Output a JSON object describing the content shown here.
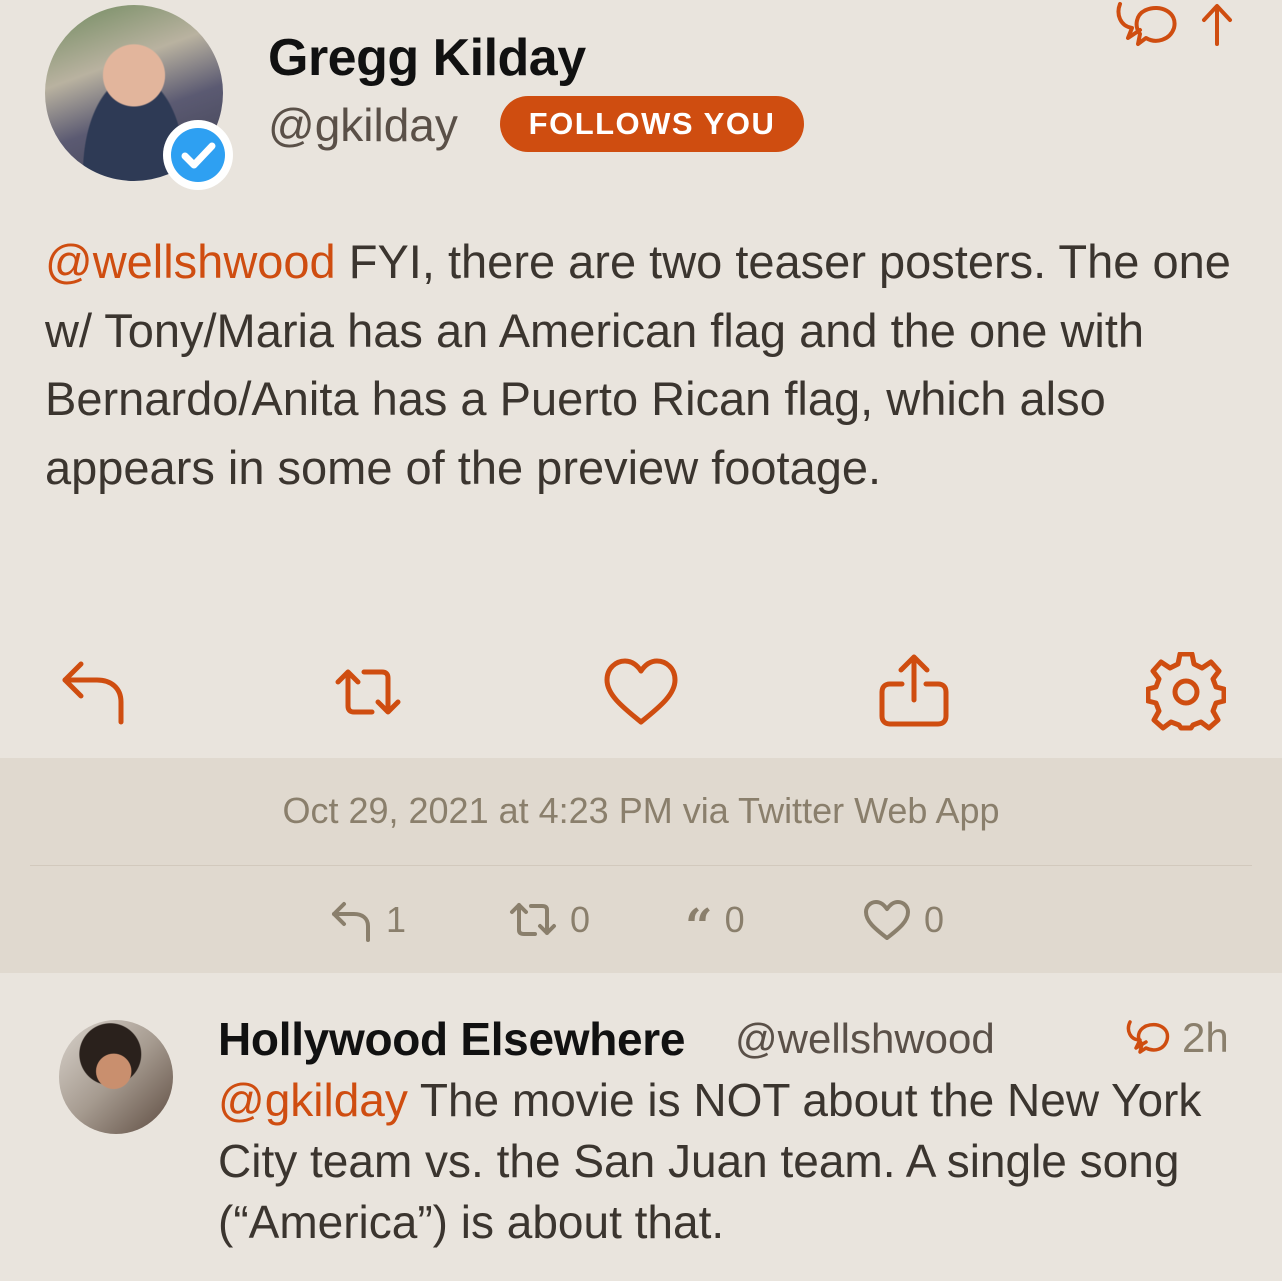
{
  "author": {
    "name": "Gregg Kilday",
    "handle": "@gkilday",
    "follows_badge": "FOLLOWS YOU",
    "verified": true
  },
  "tweet": {
    "mention": "@wellshwood",
    "text": " FYI, there are two teaser posters. The one w/ Tony/Maria has an American flag and the one with Bernardo/Anita has a Puerto Rican flag, which also appears in some of the preview footage."
  },
  "actions": [
    "reply-icon",
    "retweet-icon",
    "heart-icon",
    "share-icon",
    "gear-icon"
  ],
  "meta": {
    "timestamp": "Oct 29, 2021 at 4:23 PM via Twitter Web App",
    "stats": {
      "replies": "1",
      "retweets": "0",
      "quotes": "0",
      "likes": "0"
    }
  },
  "reply": {
    "name": "Hollywood Elsewhere",
    "handle": "@wellshwood",
    "time": "2h",
    "mention": "@gkilday",
    "text": " The movie is NOT about the New York City team vs. the San Juan team. A single song (“America”) is about that."
  },
  "colors": {
    "accent": "#cf4d10",
    "background": "#e9e4dd",
    "meta_panel": "#e0d9cf",
    "muted": "#8a7f6c"
  }
}
